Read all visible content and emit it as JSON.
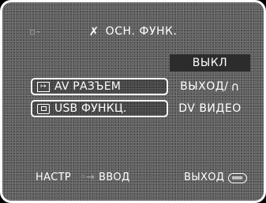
{
  "header": {
    "title": "ОСН. ФУНК.",
    "tool_icon": "wrench-icon",
    "top_mark": "▫–"
  },
  "menu": {
    "items": [
      {
        "label": "",
        "value": "ВЫКЛ",
        "icon": null,
        "state": "dimmed"
      },
      {
        "label": "AV РАЗЪЕМ",
        "value": "ВЫХОД/",
        "value_icon": "headphones-icon",
        "icon": "av-jack-icon",
        "state": "normal"
      },
      {
        "label": "USB ФУНКЦ.",
        "value": "DV ВИДЕО",
        "icon": "usb-icon",
        "state": "normal"
      }
    ]
  },
  "footer": {
    "setup_label": "НАСТР",
    "enter_label": "ВВОД",
    "exit_label": "ВЫХОД",
    "enter_icon": "joystick-icon",
    "exit_icon": "menu-button-icon"
  }
}
